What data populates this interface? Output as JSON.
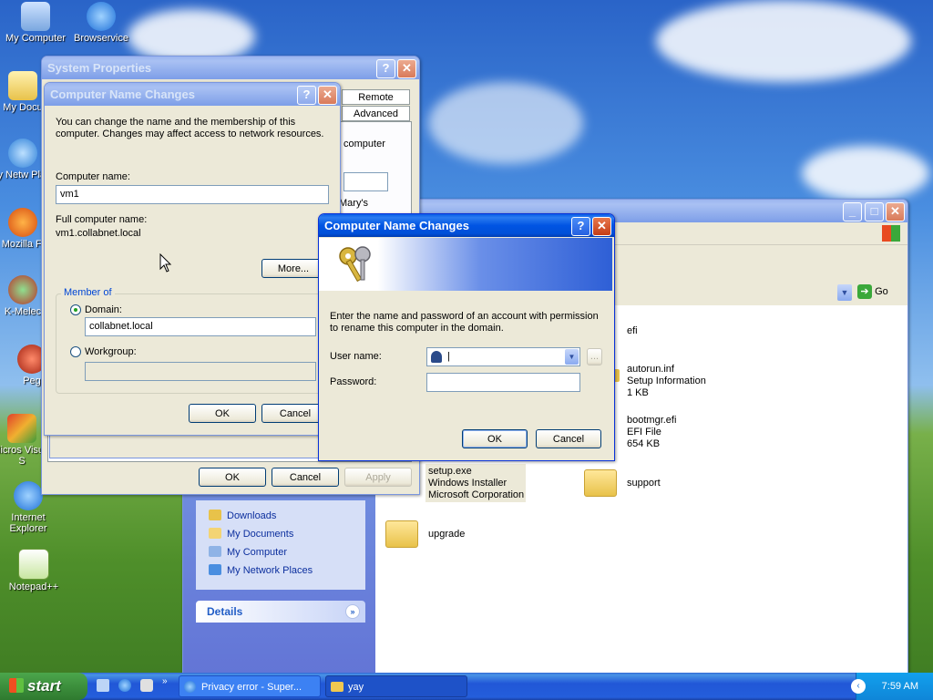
{
  "desktop": {
    "icons": [
      {
        "label": "My Computer"
      },
      {
        "label": "Browservice"
      },
      {
        "label": "My Docu"
      },
      {
        "label": "My Netw Place"
      },
      {
        "label": "Mozilla Fi"
      },
      {
        "label": "K-Melec"
      },
      {
        "label": "Peg"
      },
      {
        "label": "Micros Visual S"
      },
      {
        "label": "Internet Explorer"
      },
      {
        "label": "Notepad++"
      }
    ]
  },
  "system_properties": {
    "title": "System Properties",
    "tabs": [
      "Remote",
      "Advanced"
    ],
    "partial_text": [
      "computer",
      "Mary's"
    ],
    "ok": "OK",
    "cancel": "Cancel",
    "apply": "Apply"
  },
  "name_changes": {
    "title": "Computer Name Changes",
    "intro": "You can change the name and the membership of this computer. Changes may affect access to network resources.",
    "computer_name_label": "Computer name:",
    "computer_name_value": "vm1",
    "full_name_label": "Full computer name:",
    "full_name_value": "vm1.collabnet.local",
    "more": "More...",
    "member_of": "Member of",
    "domain_label": "Domain:",
    "domain_value": "collabnet.local",
    "workgroup_label": "Workgroup:",
    "workgroup_value": "",
    "ok": "OK",
    "cancel": "Cancel"
  },
  "credentials": {
    "title": "Computer Name Changes",
    "message": "Enter the name and password of an account with permission to rename this computer in the domain.",
    "user_label": "User name:",
    "user_value": "|",
    "password_label": "Password:",
    "password_value": "",
    "browse": "...",
    "ok": "OK",
    "cancel": "Cancel"
  },
  "explorer": {
    "go": "Go",
    "links": [
      "Downloads",
      "My Documents",
      "My Computer",
      "My Network Places"
    ],
    "details": "Details",
    "files": [
      {
        "name": "efi",
        "type": "",
        "size": ""
      },
      {
        "name": "autorun.inf",
        "type": "Setup Information",
        "size": "1 KB"
      },
      {
        "name": "bootmgr.efi",
        "type": "EFI File",
        "size": "654 KB"
      },
      {
        "name": "setup.exe",
        "type": "Windows Installer",
        "size": "Microsoft Corporation"
      },
      {
        "name": "support",
        "type": "",
        "size": ""
      },
      {
        "name": "upgrade",
        "type": "",
        "size": ""
      }
    ]
  },
  "taskbar": {
    "start": "start",
    "tasks": [
      "Privacy error - Super...",
      "yay"
    ],
    "clock": "7:59 AM"
  },
  "colors": {
    "titlebar": "#0054e3",
    "start": "#3c8f3c",
    "desktop_sky": "#4a8ee0"
  }
}
